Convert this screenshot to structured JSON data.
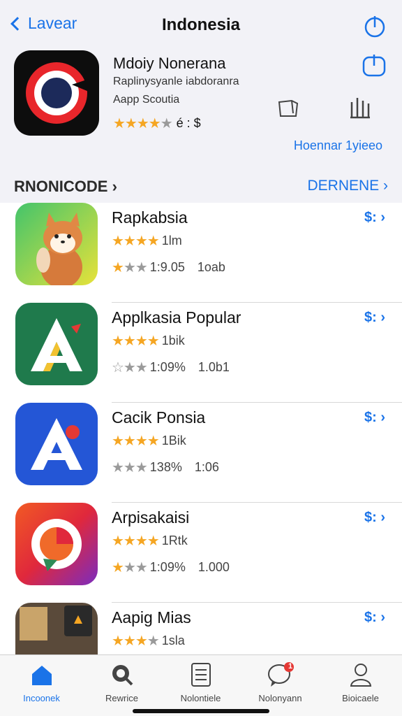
{
  "nav": {
    "back_label": "Lavear",
    "title": "Indonesia"
  },
  "featured": {
    "name": "Mdoiy Nonerana",
    "subtitle": "Raplinysyanle iabdoranra",
    "category": "Aapp Scoutia",
    "rating_text": "é : $",
    "link": "Hoennar 1yieeo"
  },
  "section": {
    "title": "RNONICODE",
    "link": "DERNENE"
  },
  "apps": [
    {
      "name": "Rapkabsia",
      "line1": "1lm",
      "line2": "1:9.05",
      "line2_extra": "1oab",
      "price": "$:"
    },
    {
      "name": "Applkasia Popular",
      "line1": "1bik",
      "line2": "1:09%",
      "line2_extra": "1.0b1",
      "price": "$:"
    },
    {
      "name": "Cacik Ponsia",
      "line1": "1Bik",
      "line2": "138%",
      "line2_extra": "1:06",
      "price": "$:"
    },
    {
      "name": "Arpisakaisi",
      "line1": "1Rtk",
      "line2": "1:09%",
      "line2_extra": "1.000",
      "price": "$:"
    },
    {
      "name": "Aapig Mias",
      "line1": "1sla",
      "line2": "",
      "line2_extra": "",
      "price": "$:"
    }
  ],
  "tabs": [
    {
      "label": "Incoonek",
      "icon": "home-icon",
      "active": true
    },
    {
      "label": "Rewrice",
      "icon": "search-icon",
      "active": false
    },
    {
      "label": "Nolontiele",
      "icon": "document-icon",
      "active": false
    },
    {
      "label": "Nolonyann",
      "icon": "chat-icon",
      "active": false,
      "badge": "1"
    },
    {
      "label": "Bioicaele",
      "icon": "person-icon",
      "active": false
    }
  ],
  "colors": {
    "accent": "#1a73e8",
    "star": "#f5a623",
    "badge": "#e53935"
  }
}
